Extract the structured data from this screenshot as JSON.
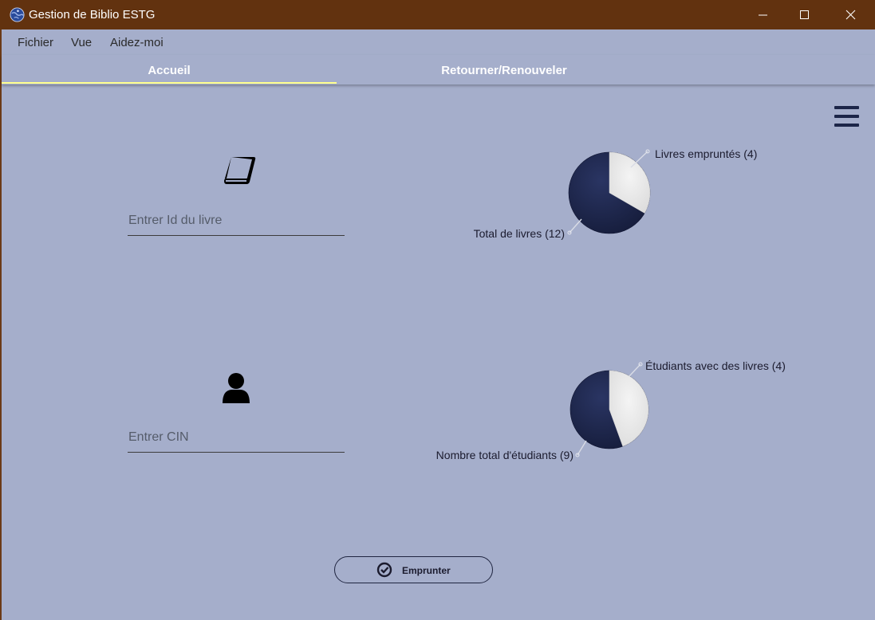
{
  "window": {
    "title": "Gestion de Biblio ESTG",
    "app_icon": "globe-icon",
    "controls": [
      "minimize-icon",
      "maximize-icon",
      "close-icon"
    ]
  },
  "menubar": {
    "items": [
      "Fichier",
      "Vue",
      "Aidez-moi"
    ]
  },
  "tabs": [
    {
      "label": "Accueil",
      "active": true
    },
    {
      "label": "Retourner/Renouveler",
      "active": false
    }
  ],
  "main": {
    "menu_icon": "hamburger-menu-icon",
    "book_section": {
      "icon": "book-icon",
      "input_placeholder": "Entrer Id du livre"
    },
    "student_section": {
      "icon": "user-icon",
      "input_placeholder": "Entrer CIN"
    },
    "action_button": {
      "label": "Emprunter",
      "icon": "check-circle-icon"
    }
  },
  "colors": {
    "titlebar": "#62320f",
    "background": "#a5aecb",
    "pie_dark": "#1c2548",
    "pie_light": "#ececec",
    "tab_indicator": "#ffff8d"
  },
  "chart_data": [
    {
      "type": "pie",
      "slices": [
        {
          "label": "Livres empruntés (4)",
          "value": 4
        },
        {
          "label": "Total de livres (12)",
          "value": 12
        }
      ]
    },
    {
      "type": "pie",
      "slices": [
        {
          "label": "Étudiants avec des livres (4)",
          "value": 4
        },
        {
          "label": "Nombre total d'étudiants (9)",
          "value": 9
        }
      ]
    }
  ]
}
